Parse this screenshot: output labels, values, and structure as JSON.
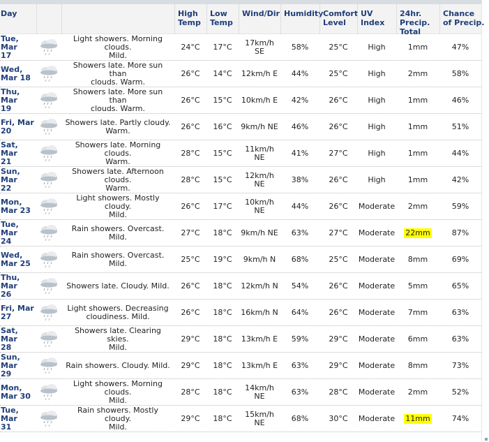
{
  "columns": [
    {
      "key": "day",
      "lines": [
        "Day"
      ]
    },
    {
      "key": "icon",
      "lines": [
        ""
      ]
    },
    {
      "key": "desc",
      "lines": [
        ""
      ]
    },
    {
      "key": "high",
      "lines": [
        "High",
        "Temp"
      ]
    },
    {
      "key": "low",
      "lines": [
        "Low",
        "Temp"
      ]
    },
    {
      "key": "wind",
      "lines": [
        "Wind/Dir"
      ]
    },
    {
      "key": "hum",
      "lines": [
        "Humidity"
      ]
    },
    {
      "key": "comf",
      "lines": [
        "Comfort",
        "Level"
      ]
    },
    {
      "key": "uv",
      "lines": [
        "UV",
        "Index"
      ]
    },
    {
      "key": "precip",
      "lines": [
        "24hr.",
        "Precip.",
        "Total"
      ]
    },
    {
      "key": "chance",
      "lines": [
        "Chance",
        "of Precip."
      ]
    }
  ],
  "weather_icon": "cloud-rain-icon",
  "highlight_color": "#ffff00",
  "rows": [
    {
      "day": [
        "Tue, Mar",
        "17"
      ],
      "desc": [
        "Light showers. Morning clouds.",
        "Mild."
      ],
      "high": "24°C",
      "low": "17°C",
      "wind": [
        "17km/h",
        "SE"
      ],
      "hum": "58%",
      "comf": "25°C",
      "uv": "High",
      "precip": "1mm",
      "precip_highlight": false,
      "chance": "47%"
    },
    {
      "day": [
        "Wed,",
        "Mar 18"
      ],
      "desc": [
        "Showers late. More sun than",
        "clouds. Warm."
      ],
      "high": "26°C",
      "low": "14°C",
      "wind": [
        "12km/h E"
      ],
      "hum": "44%",
      "comf": "25°C",
      "uv": "High",
      "precip": "2mm",
      "precip_highlight": false,
      "chance": "58%"
    },
    {
      "day": [
        "Thu, Mar",
        "19"
      ],
      "desc": [
        "Showers late. More sun than",
        "clouds. Warm."
      ],
      "high": "26°C",
      "low": "15°C",
      "wind": [
        "10km/h E"
      ],
      "hum": "42%",
      "comf": "26°C",
      "uv": "High",
      "precip": "1mm",
      "precip_highlight": false,
      "chance": "46%"
    },
    {
      "day": [
        "Fri, Mar",
        "20"
      ],
      "desc": [
        "Showers late. Partly cloudy.",
        "Warm."
      ],
      "high": "26°C",
      "low": "16°C",
      "wind": [
        "9km/h NE"
      ],
      "hum": "46%",
      "comf": "26°C",
      "uv": "High",
      "precip": "1mm",
      "precip_highlight": false,
      "chance": "51%"
    },
    {
      "day": [
        "Sat, Mar",
        "21"
      ],
      "desc": [
        "Showers late. Morning clouds.",
        "Warm."
      ],
      "high": "28°C",
      "low": "15°C",
      "wind": [
        "11km/h",
        "NE"
      ],
      "hum": "41%",
      "comf": "27°C",
      "uv": "High",
      "precip": "1mm",
      "precip_highlight": false,
      "chance": "44%"
    },
    {
      "day": [
        "Sun, Mar",
        "22"
      ],
      "desc": [
        "Showers late. Afternoon clouds.",
        "Warm."
      ],
      "high": "28°C",
      "low": "15°C",
      "wind": [
        "12km/h",
        "NE"
      ],
      "hum": "38%",
      "comf": "26°C",
      "uv": "High",
      "precip": "1mm",
      "precip_highlight": false,
      "chance": "42%"
    },
    {
      "day": [
        "Mon,",
        "Mar 23"
      ],
      "desc": [
        "Light showers. Mostly cloudy.",
        "Mild."
      ],
      "high": "26°C",
      "low": "17°C",
      "wind": [
        "10km/h",
        "NE"
      ],
      "hum": "44%",
      "comf": "26°C",
      "uv": "Moderate",
      "precip": "2mm",
      "precip_highlight": false,
      "chance": "59%"
    },
    {
      "day": [
        "Tue, Mar",
        "24"
      ],
      "desc": [
        "Rain showers. Overcast. Mild."
      ],
      "high": "27°C",
      "low": "18°C",
      "wind": [
        "9km/h NE"
      ],
      "hum": "63%",
      "comf": "27°C",
      "uv": "Moderate",
      "precip": "22mm",
      "precip_highlight": true,
      "chance": "87%"
    },
    {
      "day": [
        "Wed,",
        "Mar 25"
      ],
      "desc": [
        "Rain showers. Overcast. Mild."
      ],
      "high": "25°C",
      "low": "19°C",
      "wind": [
        "9km/h N"
      ],
      "hum": "68%",
      "comf": "25°C",
      "uv": "Moderate",
      "precip": "8mm",
      "precip_highlight": false,
      "chance": "69%"
    },
    {
      "day": [
        "Thu, Mar",
        "26"
      ],
      "desc": [
        "Showers late. Cloudy. Mild."
      ],
      "high": "26°C",
      "low": "18°C",
      "wind": [
        "12km/h N"
      ],
      "hum": "54%",
      "comf": "26°C",
      "uv": "Moderate",
      "precip": "5mm",
      "precip_highlight": false,
      "chance": "65%"
    },
    {
      "day": [
        "Fri, Mar",
        "27"
      ],
      "desc": [
        "Light showers. Decreasing",
        "cloudiness. Mild."
      ],
      "high": "26°C",
      "low": "18°C",
      "wind": [
        "16km/h N"
      ],
      "hum": "64%",
      "comf": "26°C",
      "uv": "Moderate",
      "precip": "7mm",
      "precip_highlight": false,
      "chance": "63%"
    },
    {
      "day": [
        "Sat, Mar",
        "28"
      ],
      "desc": [
        "Showers late. Clearing skies.",
        "Mild."
      ],
      "high": "29°C",
      "low": "18°C",
      "wind": [
        "13km/h E"
      ],
      "hum": "59%",
      "comf": "29°C",
      "uv": "Moderate",
      "precip": "6mm",
      "precip_highlight": false,
      "chance": "63%"
    },
    {
      "day": [
        "Sun, Mar",
        "29"
      ],
      "desc": [
        "Rain showers. Cloudy. Mild."
      ],
      "high": "29°C",
      "low": "18°C",
      "wind": [
        "13km/h E"
      ],
      "hum": "63%",
      "comf": "29°C",
      "uv": "Moderate",
      "precip": "8mm",
      "precip_highlight": false,
      "chance": "73%"
    },
    {
      "day": [
        "Mon,",
        "Mar 30"
      ],
      "desc": [
        "Light showers. Morning clouds.",
        "Mild."
      ],
      "high": "28°C",
      "low": "18°C",
      "wind": [
        "14km/h",
        "NE"
      ],
      "hum": "63%",
      "comf": "28°C",
      "uv": "Moderate",
      "precip": "2mm",
      "precip_highlight": false,
      "chance": "52%"
    },
    {
      "day": [
        "Tue, Mar",
        "31"
      ],
      "desc": [
        "Rain showers. Mostly cloudy.",
        "Mild."
      ],
      "high": "29°C",
      "low": "18°C",
      "wind": [
        "15km/h",
        "NE"
      ],
      "hum": "68%",
      "comf": "30°C",
      "uv": "Moderate",
      "precip": "11mm",
      "precip_highlight": true,
      "chance": "74%"
    }
  ]
}
